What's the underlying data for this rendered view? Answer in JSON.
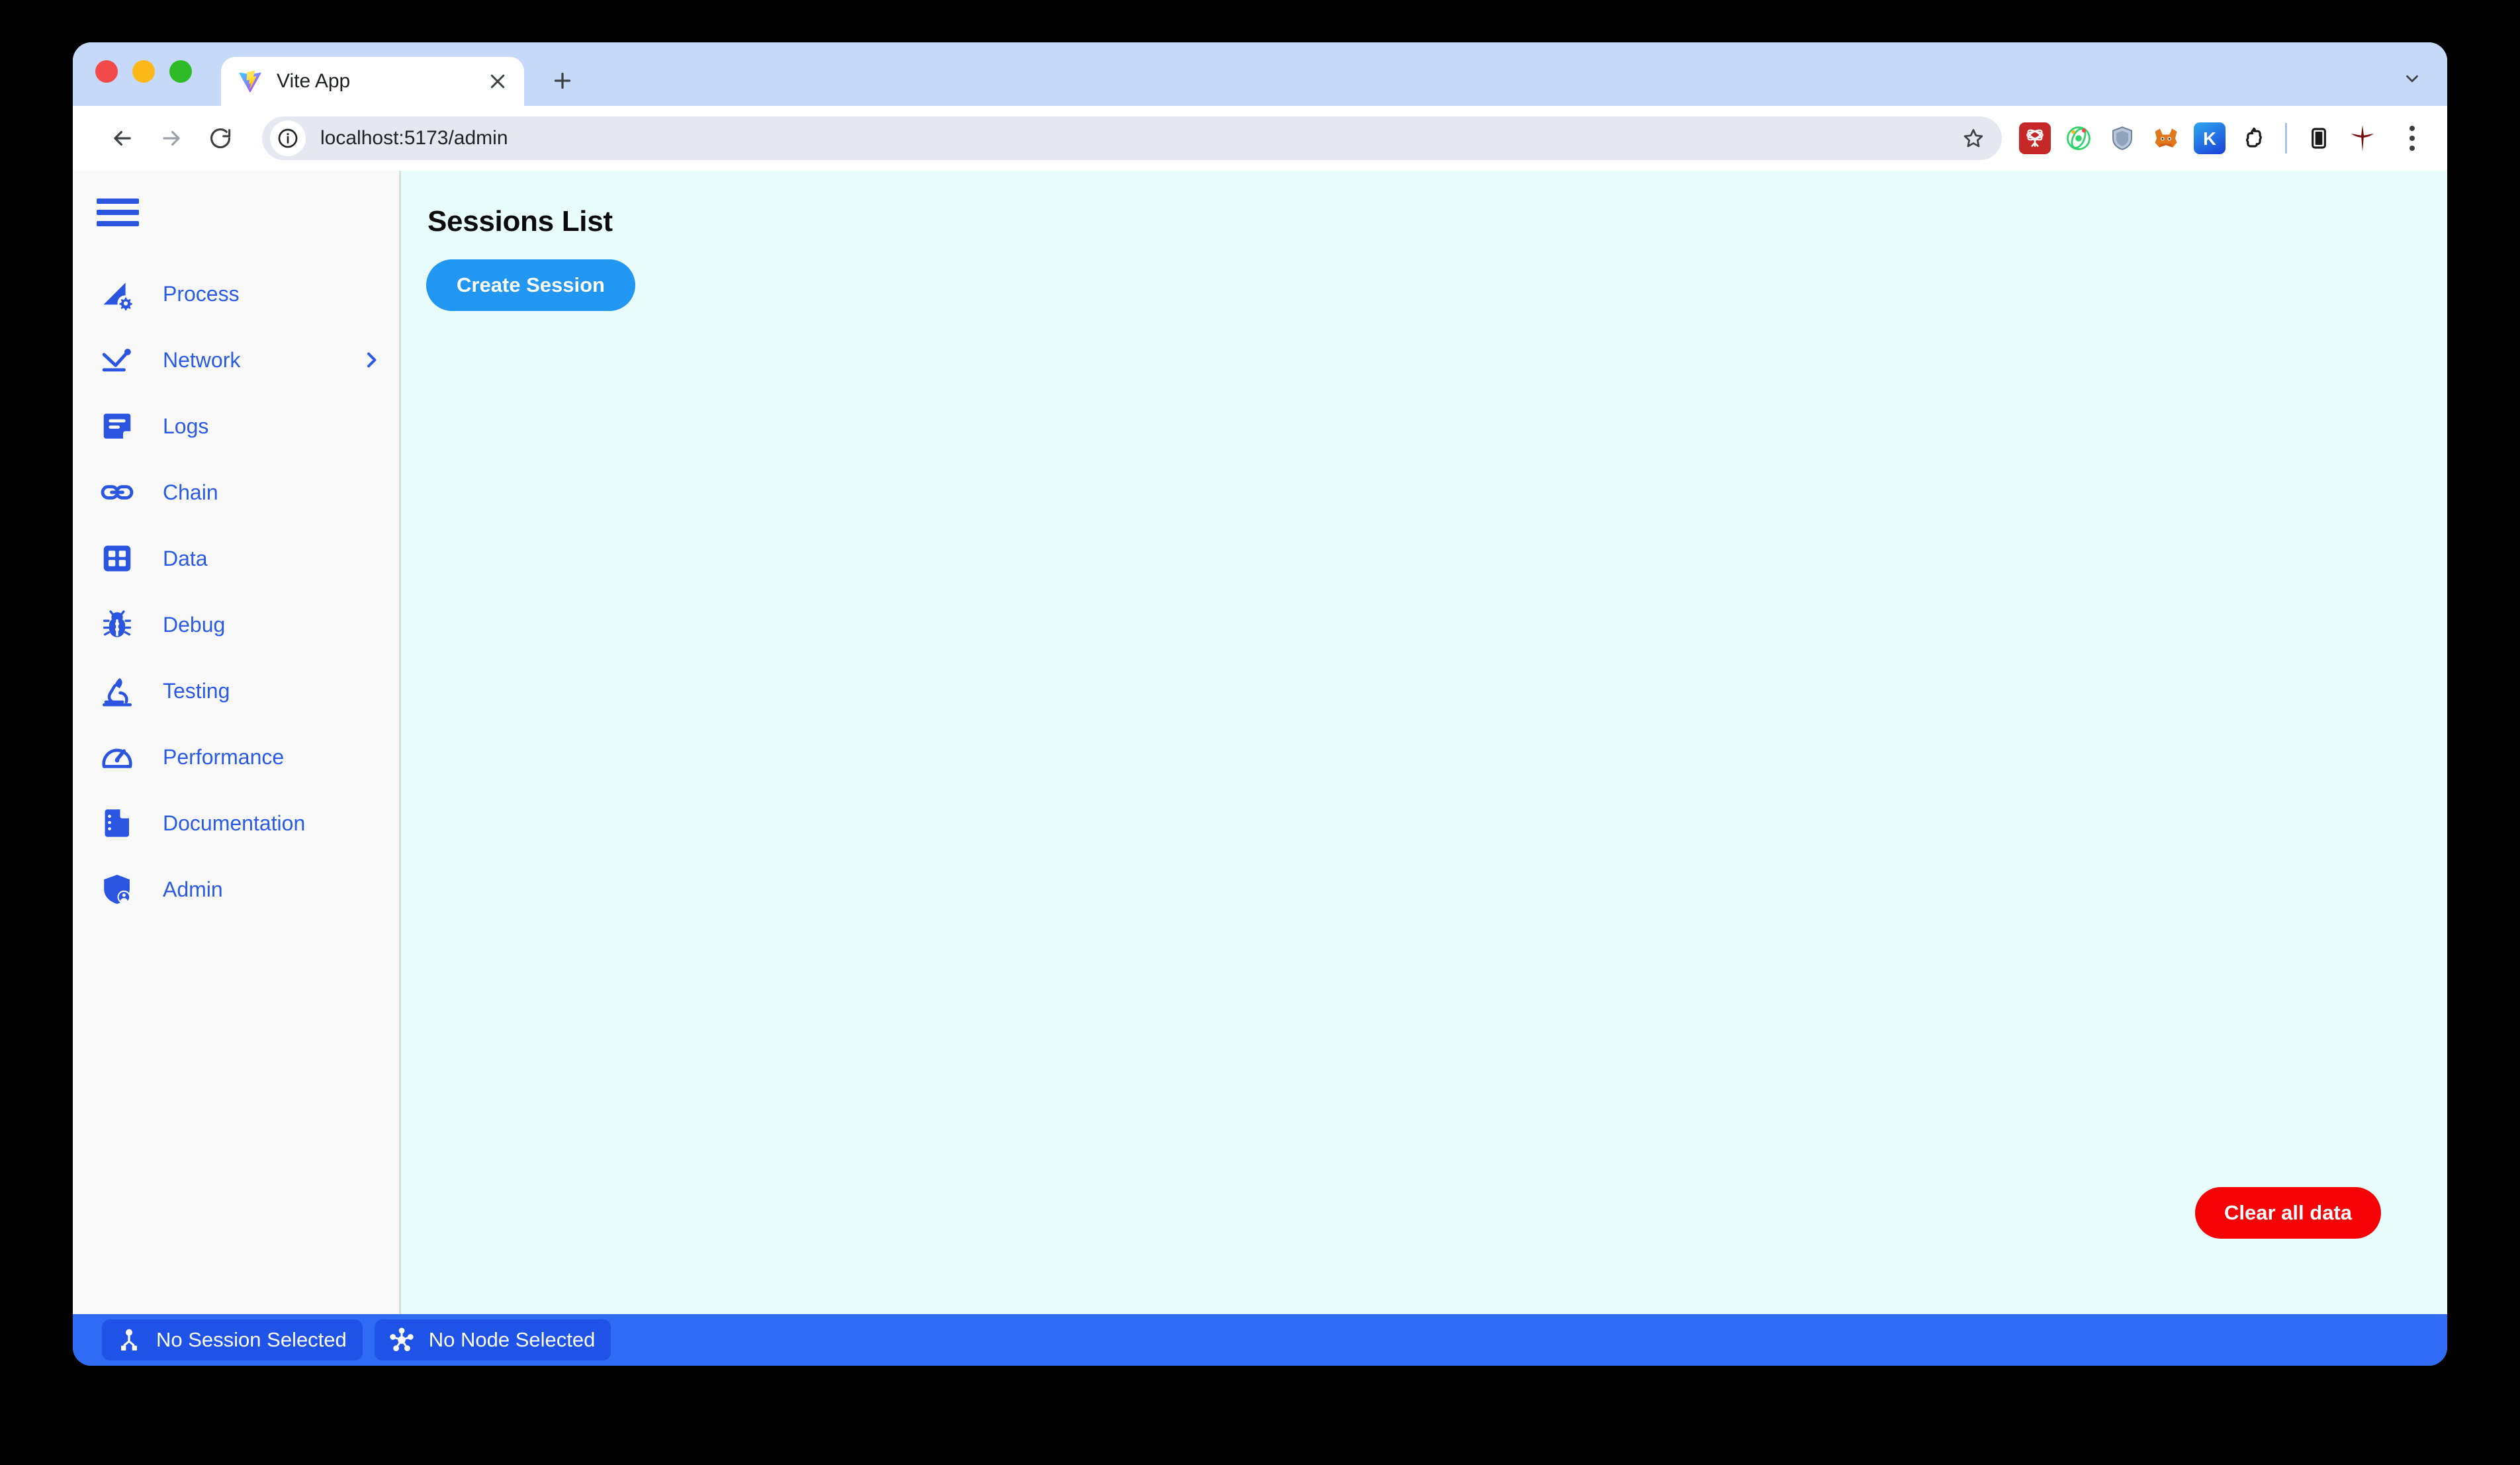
{
  "browser": {
    "tab": {
      "title": "Vite App",
      "favicon": "vite-logo-icon",
      "close_icon": "close-icon"
    },
    "new_tab_icon": "plus-icon",
    "tab_list_icon": "chevron-down-icon",
    "nav": {
      "back_icon": "arrow-back-icon",
      "forward_icon": "arrow-forward-icon",
      "reload_icon": "reload-icon"
    },
    "omnibox": {
      "info_icon": "info-circle-icon",
      "url": "localhost:5173/admin",
      "bookmark_icon": "star-icon"
    },
    "extensions": [
      {
        "name": "react-devtools-extension",
        "color": "#c62828"
      },
      {
        "name": "orbit-extension",
        "color": "#25c462"
      },
      {
        "name": "shield-extension",
        "color": "#8fa7c4"
      },
      {
        "name": "metamask-extension",
        "color": "#e2761b"
      },
      {
        "name": "keplr-extension",
        "color": "#1f6fe0"
      },
      {
        "name": "phantom-extension",
        "color": "#1a1a1a"
      },
      {
        "name": "split-view-extension",
        "color": "#1a1a1a"
      },
      {
        "name": "quake-extension",
        "color": "#8b0000"
      }
    ],
    "menu_icon": "kebab-menu-icon"
  },
  "sidebar": {
    "menu_toggle": "hamburger-icon",
    "items": [
      {
        "label": "Process",
        "icon": "process-gear-icon",
        "expandable": false
      },
      {
        "label": "Network",
        "icon": "network-icon",
        "expandable": true,
        "chevron": "chevron-right-icon"
      },
      {
        "label": "Logs",
        "icon": "logs-icon",
        "expandable": false
      },
      {
        "label": "Chain",
        "icon": "chain-link-icon",
        "expandable": false
      },
      {
        "label": "Data",
        "icon": "data-grid-icon",
        "expandable": false
      },
      {
        "label": "Debug",
        "icon": "bug-icon",
        "expandable": false
      },
      {
        "label": "Testing",
        "icon": "microscope-icon",
        "expandable": false
      },
      {
        "label": "Performance",
        "icon": "speedometer-icon",
        "expandable": false
      },
      {
        "label": "Documentation",
        "icon": "document-icon",
        "expandable": false
      },
      {
        "label": "Admin",
        "icon": "shield-user-icon",
        "expandable": false
      }
    ]
  },
  "main": {
    "title": "Sessions List",
    "create_session_label": "Create Session",
    "clear_all_label": "Clear all data"
  },
  "status_bar": {
    "session_chip": {
      "label": "No Session Selected",
      "icon": "session-node-icon"
    },
    "node_chip": {
      "label": "No Node Selected",
      "icon": "node-graph-icon"
    }
  },
  "colors": {
    "accent_blue": "#2a5ae8",
    "create_button": "#2196f3",
    "danger_red": "#f60105",
    "status_bar": "#2f6bf4",
    "status_chip": "#1f53e8",
    "main_bg": "#eafdfd",
    "sidebar_bg": "#faf9fa",
    "tab_strip": "#c7d9f8"
  }
}
